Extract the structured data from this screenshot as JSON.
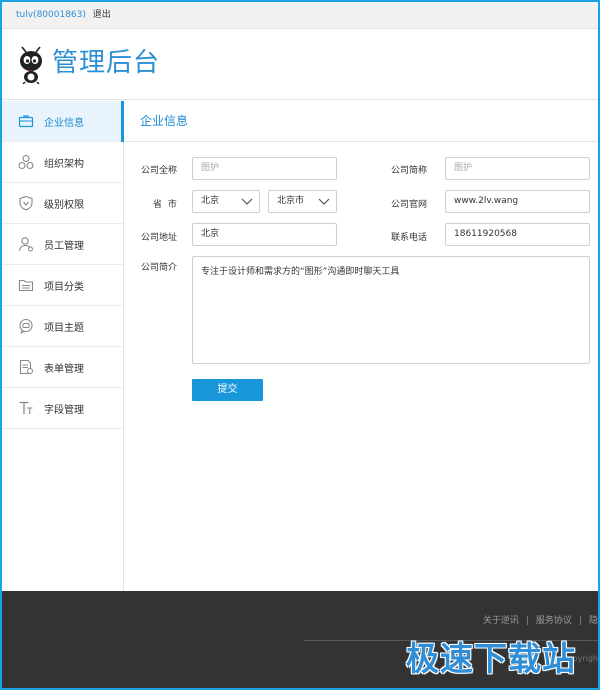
{
  "topbar": {
    "user": "tulv(80001863)",
    "logout": "退出"
  },
  "header": {
    "brand": "管理后台"
  },
  "sidebar": {
    "items": [
      {
        "label": "企业信息",
        "icon": "briefcase-icon",
        "active": true
      },
      {
        "label": "组织架构",
        "icon": "org-chart-icon"
      },
      {
        "label": "级别权限",
        "icon": "shield-icon"
      },
      {
        "label": "员工管理",
        "icon": "user-icon"
      },
      {
        "label": "项目分类",
        "icon": "folder-icon"
      },
      {
        "label": "项目主题",
        "icon": "chat-bubble-icon"
      },
      {
        "label": "表单管理",
        "icon": "form-icon"
      },
      {
        "label": "字段管理",
        "icon": "text-field-icon"
      }
    ]
  },
  "main": {
    "title": "企业信息",
    "form": {
      "full_name_label": "公司全称",
      "full_name_placeholder": "图护",
      "short_name_label": "公司简称",
      "short_name_placeholder": "图护",
      "province_city_label": "省  市",
      "province_value": "北京",
      "city_value": "北京市",
      "website_label": "公司官网",
      "website_value": "www.2lv.wang",
      "address_label": "公司地址",
      "address_value": "北京",
      "phone_label": "联系电话",
      "phone_value": "18611920568",
      "intro_label": "公司简介",
      "intro_value": "专注于设计师和需求方的“图形”沟通即时聊天工具",
      "submit_label": "提交"
    }
  },
  "footer": {
    "links": [
      "关于逆讯",
      "服务协议",
      "隐"
    ],
    "copyright": "Copyrigh"
  },
  "watermark": "极速下载站",
  "colors": {
    "accent": "#1a96da",
    "footer_bg": "#333333",
    "border": "#cfcfcf"
  }
}
